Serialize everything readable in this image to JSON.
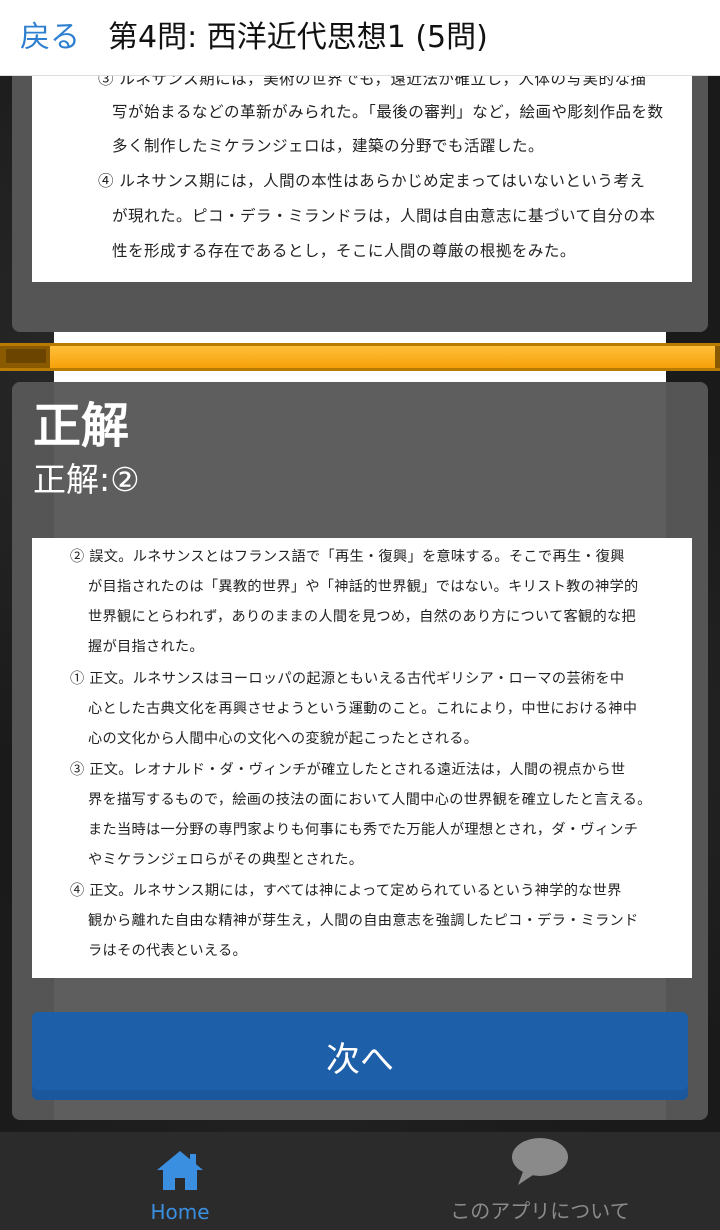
{
  "header": {
    "back_label": "戻る",
    "title": "第4問: 西洋近代思想1 (5問)"
  },
  "question": {
    "lines": [
      "③ ルネサンス期には，美術の世界でも，遠近法が確立し，人体の写実的な描",
      "写が始まるなどの革新がみられた。「最後の審判」など，絵画や彫刻作品を数",
      "多く制作したミケランジェロは，建築の分野でも活躍した。",
      "④  ルネサンス期には，人間の本性はあらかじめ定まってはいないという考え",
      "が現れた。ピコ・デラ・ミランドラは，人間は自由意志に基づいて自分の本",
      "性を形成する存在であるとし，そこに人間の尊厳の根拠をみた。"
    ]
  },
  "progress": {
    "fraction": 0.93
  },
  "answer": {
    "heading": "正解",
    "value": "正解:②"
  },
  "explanation": {
    "lines": [
      "②  誤文。ルネサンスとはフランス語で「再生・復興」を意味する。そこで再生・復興",
      "が目指されたのは「異教的世界」や「神話的世界観」ではない。キリスト教の神学的",
      "世界観にとらわれず，ありのままの人間を見つめ，自然のあり方について客観的な把",
      "握が目指された。",
      "①  正文。ルネサンスはヨーロッパの起源ともいえる古代ギリシア・ローマの芸術を中",
      "心とした古典文化を再興させようという運動のこと。これにより，中世における神中",
      "心の文化から人間中心の文化への変貌が起こったとされる。",
      "③  正文。レオナルド・ダ・ヴィンチが確立したとされる遠近法は，人間の視点から世",
      "界を描写するもので，絵画の技法の面において人間中心の世界観を確立したと言える。",
      "また当時は一分野の専門家よりも何事にも秀でた万能人が理想とされ，ダ・ヴィンチ",
      "やミケランジェロらがその典型とされた。",
      "④  正文。ルネサンス期には，すべては神によって定められているという神学的な世界",
      "観から離れた自由な精神が芽生え，人間の自由意志を強調したピコ・デラ・ミランド",
      "ラはその代表といえる。"
    ]
  },
  "next_button": {
    "label": "次へ"
  },
  "bottom_nav": {
    "items": [
      {
        "label": "Home",
        "icon": "home-icon",
        "active": true
      },
      {
        "label": "このアプリについて",
        "icon": "chat-bubble-icon",
        "active": false
      }
    ]
  },
  "colors": {
    "link_blue": "#2f7fd0",
    "button_blue": "#1e5faa",
    "progress_orange": "#f6a10a",
    "nav_active": "#3b8fe0"
  }
}
